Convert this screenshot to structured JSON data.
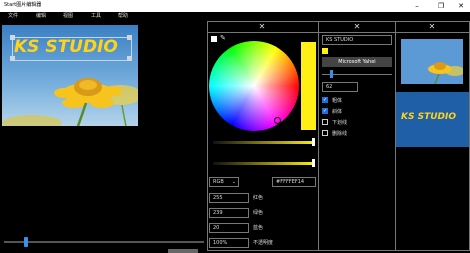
{
  "window": {
    "title": "Start图片编辑器"
  },
  "menu": [
    "文件",
    "编辑",
    "视图",
    "工具",
    "帮助"
  ],
  "canvas": {
    "overlay_text": "KS STUDIO"
  },
  "color_panel": {
    "mode": "RGB",
    "hex": "#FFFFEF14",
    "fields": [
      {
        "value": "255",
        "label": "红色"
      },
      {
        "value": "239",
        "label": "绿色"
      },
      {
        "value": "20",
        "label": "蓝色"
      },
      {
        "value": "100%",
        "label": "不透明度"
      }
    ],
    "selected_color": "#ffef14",
    "hue_slider_level": 1.0,
    "opacity_slider_level": 1.0
  },
  "text_panel": {
    "text_value": "KS STUDIO",
    "font_button": "Microsoft Yahei",
    "font_size": "62",
    "size_slider_level": 0.12,
    "options": [
      {
        "label": "粗体",
        "checked": true
      },
      {
        "label": "斜体",
        "checked": true
      },
      {
        "label": "下划线",
        "checked": false
      },
      {
        "label": "删除线",
        "checked": false
      }
    ]
  },
  "preview_panel": {
    "preview_text": "KS STUDIO"
  }
}
